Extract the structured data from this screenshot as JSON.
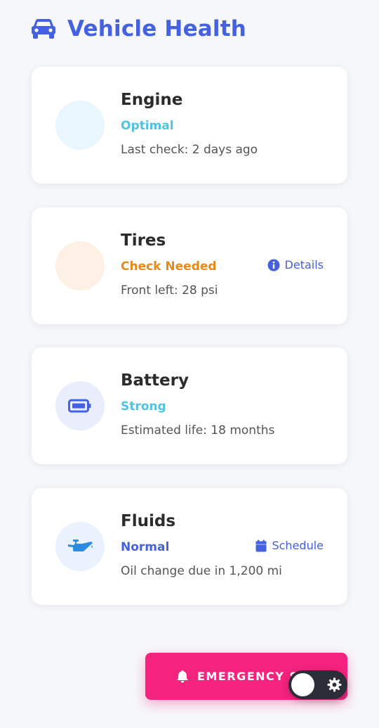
{
  "header": {
    "title": "Vehicle Health",
    "icon": "car-icon",
    "accent": "#4361e0"
  },
  "cards": [
    {
      "name": "Engine",
      "status": "Optimal",
      "status_color": "#4fc3e0",
      "detail": "Last check: 2 days ago",
      "icon": "engine-icon"
    },
    {
      "name": "Tires",
      "status": "Check Needed",
      "status_color": "#e68a1a",
      "detail": "Front left: 28 psi",
      "icon": "tire-icon",
      "action": {
        "label": "Details",
        "icon": "info-icon"
      }
    },
    {
      "name": "Battery",
      "status": "Strong",
      "status_color": "#4fc3e0",
      "detail": "Estimated life: 18 months",
      "icon": "battery-icon"
    },
    {
      "name": "Fluids",
      "status": "Normal",
      "status_color": "#4361e0",
      "detail": "Oil change due in 1,200 mi",
      "icon": "oil-can-icon",
      "action": {
        "label": "Schedule",
        "icon": "calendar-icon"
      }
    }
  ],
  "emergency": {
    "label": "EMERGENCY S",
    "icon": "bell-icon",
    "color": "#f4237e"
  },
  "theme_toggle": {
    "icon": "gear-icon",
    "state": "off"
  }
}
